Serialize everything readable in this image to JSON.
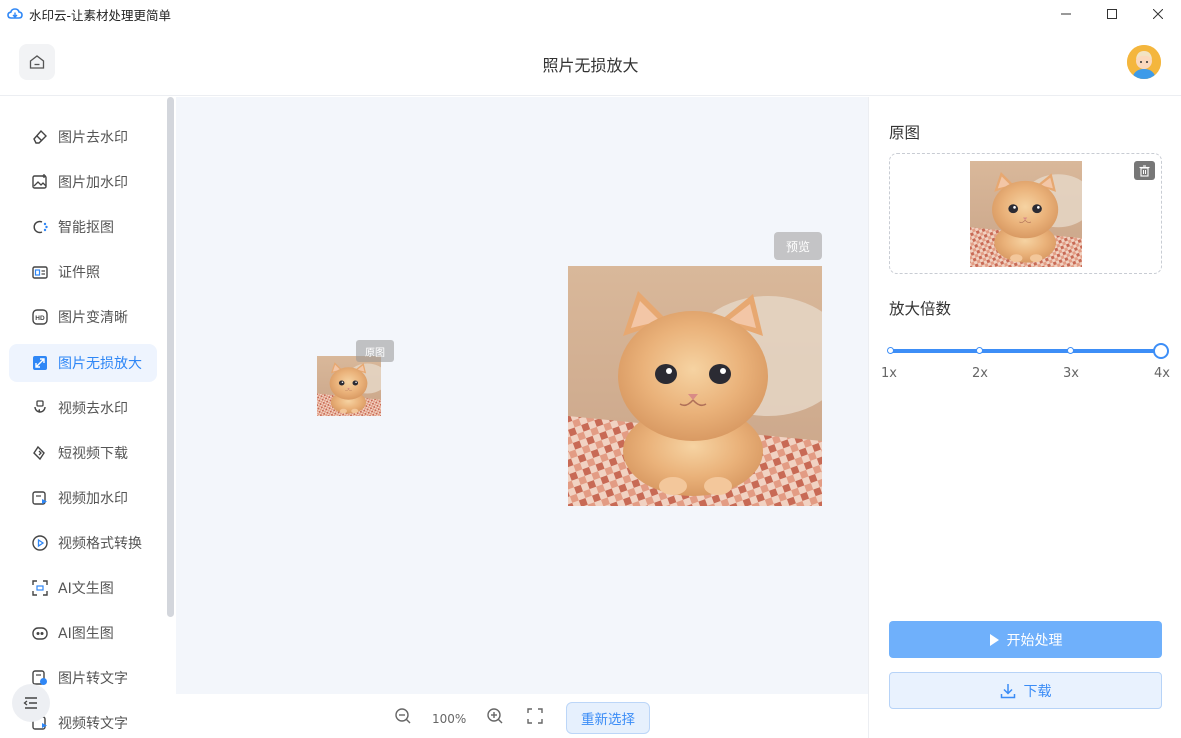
{
  "window": {
    "title": "水印云-让素材处理更简单"
  },
  "header": {
    "title": "照片无损放大"
  },
  "sidebar": {
    "items": [
      {
        "label": "图片去水印",
        "icon": "eraser-icon"
      },
      {
        "label": "图片加水印",
        "icon": "image-add-icon"
      },
      {
        "label": "智能抠图",
        "icon": "cutout-icon"
      },
      {
        "label": "证件照",
        "icon": "id-card-icon"
      },
      {
        "label": "图片变清晰",
        "icon": "hd-icon"
      },
      {
        "label": "图片无损放大",
        "icon": "enlarge-icon",
        "active": true
      },
      {
        "label": "视频去水印",
        "icon": "video-erase-icon"
      },
      {
        "label": "短视频下载",
        "icon": "link-icon"
      },
      {
        "label": "视频加水印",
        "icon": "video-add-icon"
      },
      {
        "label": "视频格式转换",
        "icon": "play-circle-icon"
      },
      {
        "label": "AI文生图",
        "icon": "ai-text-image-icon"
      },
      {
        "label": "AI图生图",
        "icon": "ai-image-image-icon"
      },
      {
        "label": "图片转文字",
        "icon": "image-text-icon"
      },
      {
        "label": "视频转文字",
        "icon": "video-text-icon"
      }
    ]
  },
  "canvas": {
    "original_tag": "原图",
    "preview_tag": "预览"
  },
  "toolbar": {
    "zoom_level": "100%",
    "reselect_label": "重新选择"
  },
  "panel": {
    "original_title": "原图",
    "scale_title": "放大倍数",
    "scale_ticks": [
      "1x",
      "2x",
      "3x",
      "4x"
    ],
    "scale_selected": "4x",
    "start_label": "开始处理",
    "download_label": "下载"
  },
  "colors": {
    "accent": "#3d8ef7",
    "active_bg": "#eef4fe",
    "canvas_bg": "#f3f6fb"
  }
}
